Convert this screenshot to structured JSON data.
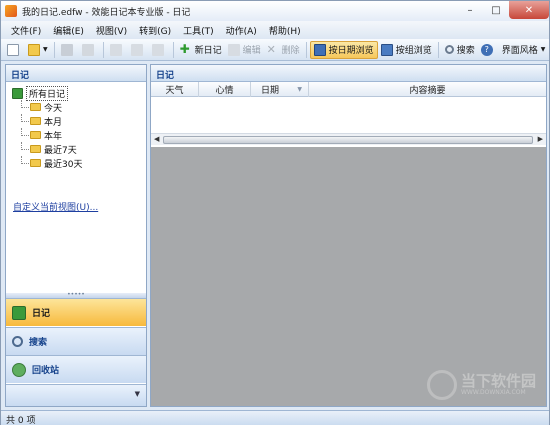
{
  "window": {
    "title": "我的日记.edfw - 效能日记本专业版 - 日记"
  },
  "menu": [
    "文件(F)",
    "编辑(E)",
    "视图(V)",
    "转到(G)",
    "工具(T)",
    "动作(A)",
    "帮助(H)"
  ],
  "toolbar": {
    "new_diary": "新日记",
    "edit": "编辑",
    "delete": "删除",
    "by_date": "按日期浏览",
    "by_group": "按组浏览",
    "search": "搜索",
    "theme": "界面风格"
  },
  "left_panel": {
    "header": "日记",
    "tree_root": "所有日记",
    "tree_items": [
      "今天",
      "本月",
      "本年",
      "最近7天",
      "最近30天"
    ],
    "custom_view_link": "自定义当前视图(U)...",
    "splitter_grip": "•••••",
    "nav": {
      "diary": "日记",
      "search": "搜索",
      "recycle": "回收站"
    }
  },
  "right_panel": {
    "header": "日记",
    "columns": [
      "天气",
      "心情",
      "日期",
      "内容摘要"
    ],
    "date_sort_glyph": "▼"
  },
  "watermark": {
    "text": "当下软件园",
    "url": "WWW.DOWNXIA.COM"
  },
  "status": {
    "count": "共 0 项"
  },
  "colors": {
    "accent": "#f7b93c",
    "header_text": "#15428b",
    "preview_bg": "#a7a9ab"
  }
}
